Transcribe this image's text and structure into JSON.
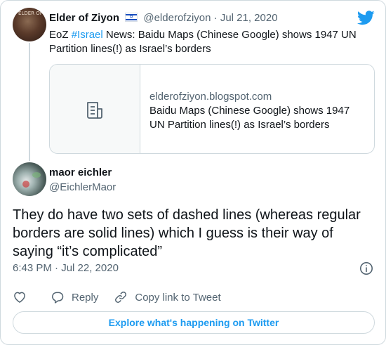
{
  "parent_tweet": {
    "author_name": "Elder of Ziyon",
    "avatar_label": "ELDER OF",
    "flag_icon": "israel-flag-icon",
    "handle": "@elderofziyon",
    "separator": "·",
    "date": "Jul 21, 2020",
    "text_prefix": "EoZ ",
    "hashtag": "#Israel",
    "text_rest": " News: Baidu Maps (Chinese Google) shows 1947 UN Partition lines(!) as Israel’s borders",
    "link_card": {
      "domain": "elderofziyon.blogspot.com",
      "title": "Baidu Maps (Chinese Google) shows 1947 UN Partition lines(!) as Israel’s borders",
      "thumbnail_icon": "document-icon"
    }
  },
  "reply": {
    "author_name": "maor eichler",
    "handle": "@EichlerMaor",
    "text": "They do have two sets of dashed lines (whereas regular borders are solid lines) which I guess is their way of saying “it’s complicated”",
    "timestamp": "6:43 PM · Jul 22, 2020"
  },
  "actions": {
    "like_icon": "heart-icon",
    "reply_label": "Reply",
    "copy_link_label": "Copy link to Tweet"
  },
  "explore_label": "Explore what's happening on Twitter",
  "colors": {
    "accent": "#1d9bf0",
    "text": "#0f1419",
    "muted": "#536471",
    "border": "#cfd9de"
  }
}
